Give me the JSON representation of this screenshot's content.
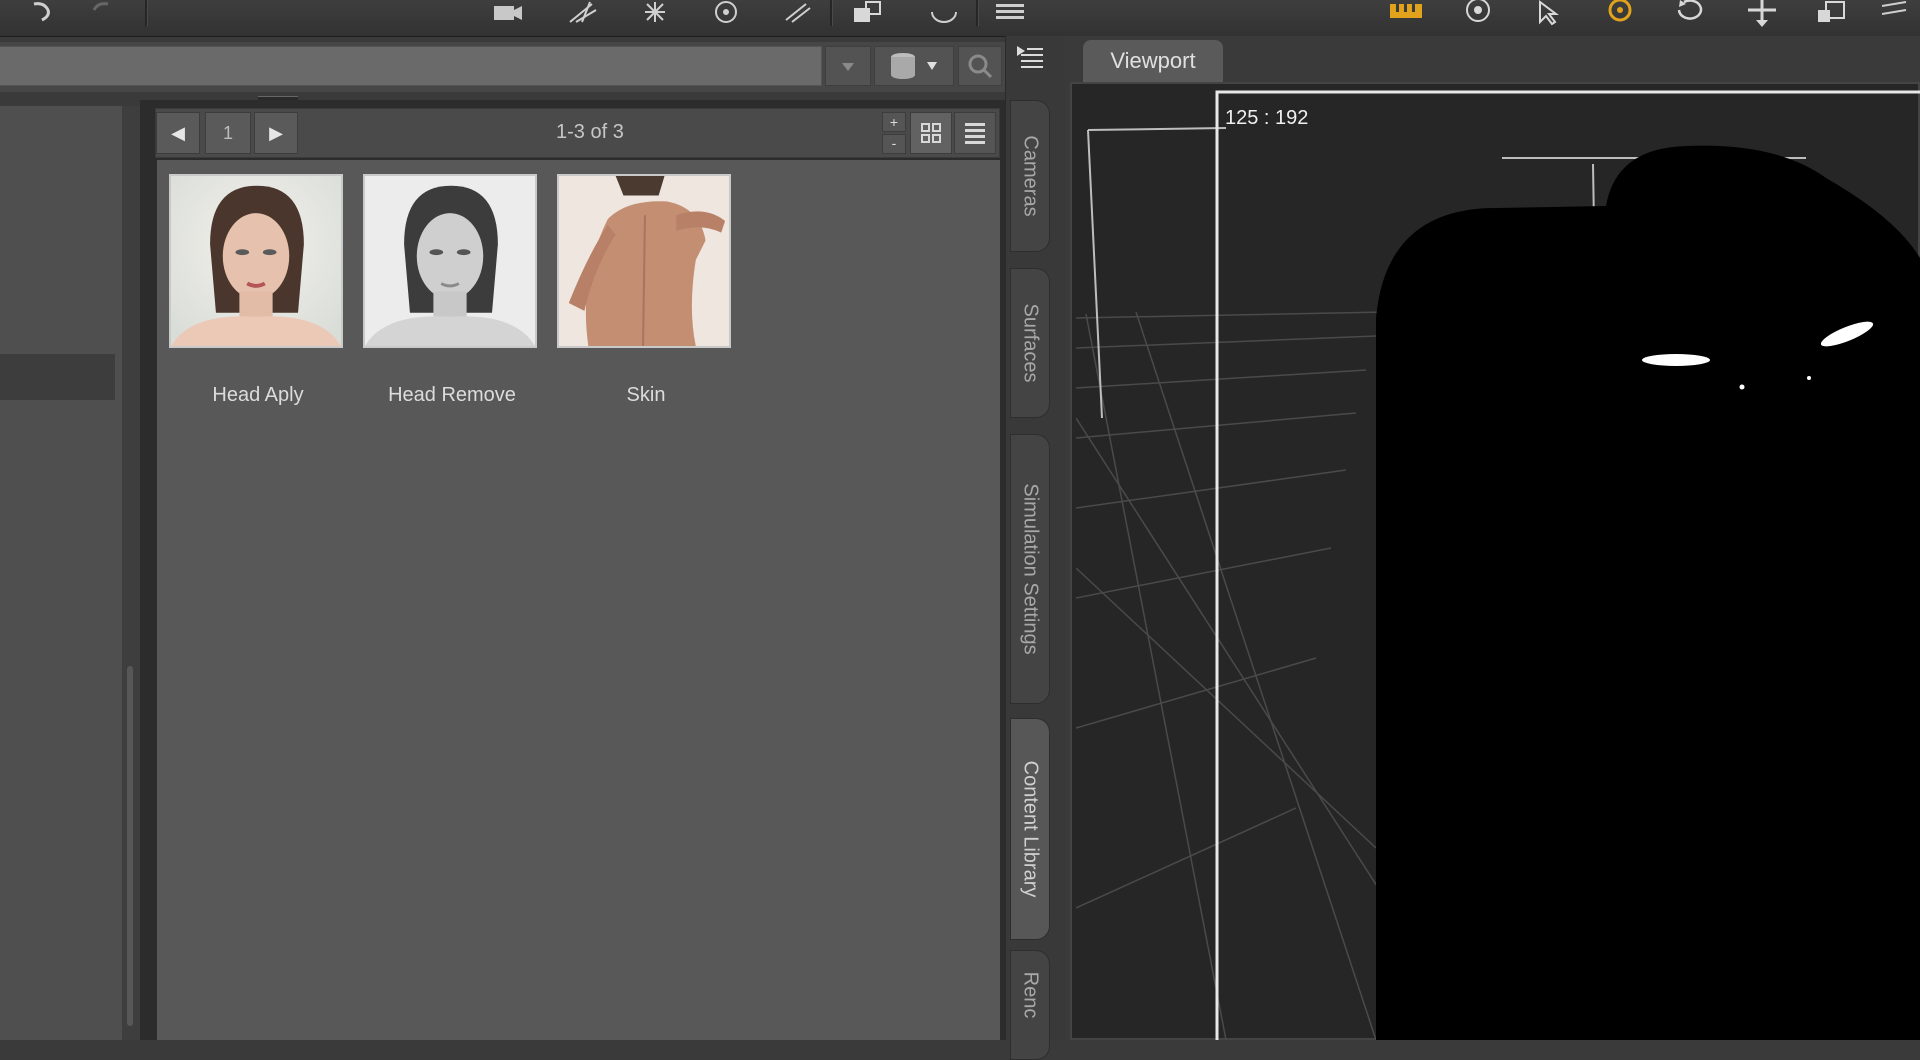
{
  "toolbar": {
    "icons": [
      "undo-icon",
      "redo-icon",
      "camera-icon",
      "spotlight-icon",
      "point-light-icon",
      "render-settings-icon",
      "distant-light-icon",
      "group-icon",
      "joint-rotate-icon",
      "menu-list-icon",
      "active-tool-icon",
      "view-sphere-icon",
      "node-select-icon",
      "universal-tool-icon",
      "rotate-icon",
      "translate-icon",
      "scale-icon",
      "more-icon"
    ]
  },
  "search": {
    "value": "",
    "placeholder": ""
  },
  "nav": {
    "page": "1",
    "range": "1-3 of 3"
  },
  "assets": [
    {
      "label": "Head Aply",
      "icon": "portrait-color-thumbnail"
    },
    {
      "label": "Head Remove",
      "icon": "portrait-gray-thumbnail"
    },
    {
      "label": "Skin",
      "icon": "back-skin-thumbnail"
    }
  ],
  "side_tabs": [
    "Cameras",
    "Surfaces",
    "Simulation Settings",
    "Content Library",
    "Renc"
  ],
  "viewport": {
    "tab_label": "Viewport",
    "coords": "125 : 192"
  },
  "colors": {
    "accent": "#e1a21c",
    "panel": "#585858",
    "viewport_bg": "#262626"
  }
}
